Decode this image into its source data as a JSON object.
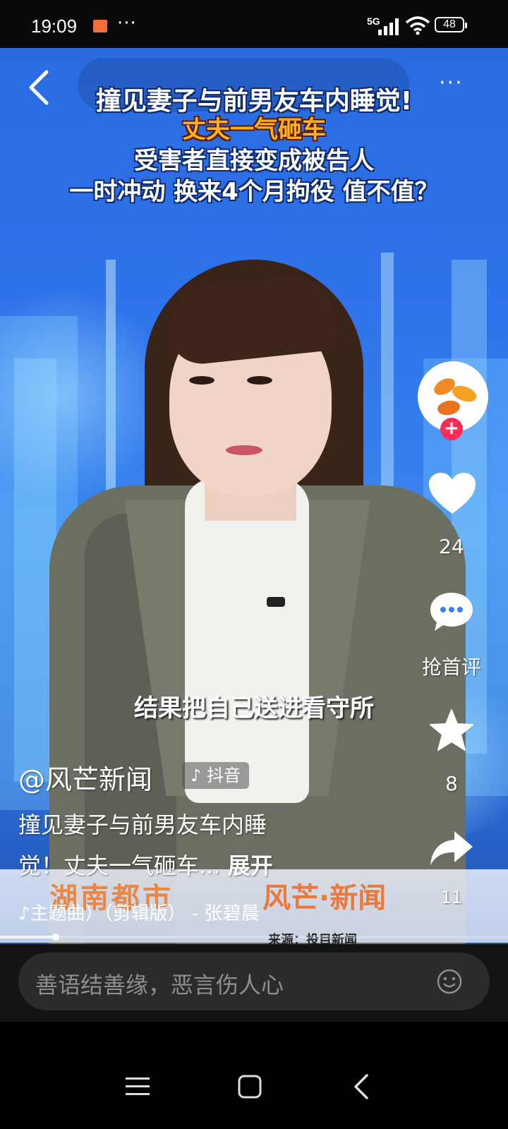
{
  "status_bar": {
    "time": "19:09",
    "dots": "···",
    "network": "5G",
    "battery": "48"
  },
  "video": {
    "headlines": [
      "撞见妻子与前男友车内睡觉!",
      "丈夫一气砸车",
      "受害者直接变成被告人",
      "一时冲动 换来4个月拘役 值不值？"
    ],
    "subtitle": "结果把自己送进看守所",
    "watermark_left": "湖南都市",
    "watermark_right": "风芒·新闻",
    "source": "来源：投目新闻",
    "progress": 0.11
  },
  "actions": {
    "like_count": "24",
    "comment_label": "抢首评",
    "favorite_count": "8",
    "share_count": "11",
    "follow_plus": "+"
  },
  "info": {
    "author": "@风芒新闻",
    "platform": "抖音",
    "desc_line1": "撞见妻子与前男友车内睡",
    "desc_line2": "觉！丈夫一气砸车...",
    "expand": "展开",
    "music": "♪主题曲）（剪辑版） - 张碧晨"
  },
  "comment_bar": {
    "placeholder": "善语结善缘，恶言伤人心"
  },
  "colors": {
    "accent_red": "#ff2d55",
    "headline_orange": "#ffb020",
    "brand_orange": "#f08a24"
  }
}
